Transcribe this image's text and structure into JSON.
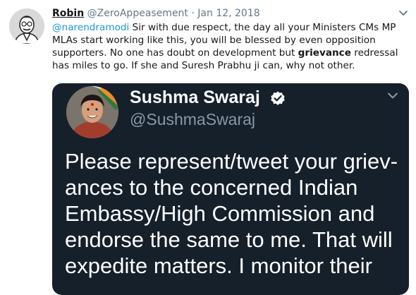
{
  "tweet": {
    "author_name": "Robin",
    "author_handle": "@ZeroAppeasement",
    "separator": "·",
    "date": "Jan 12, 2018",
    "mention": "@narendramodi",
    "text_part1": " Sir with due respect, the day all your Ministers CMs MP MLAs start working like this, you will be blessed by even opposition supporters. No one has doubt on development but ",
    "bold_word": "grievance",
    "text_part2": " redressal has miles to go. If she and Suresh Prabhu ji can, why not other.",
    "icons": {
      "avatar": "cartoon-avatar-icon",
      "menu": "chevron-down-icon"
    }
  },
  "quoted": {
    "author_name": "Sushma Swaraj",
    "author_handle": "@SushmaSwaraj",
    "lines": [
      "Please represent/tweet your griev-",
      "ances to the concerned Indian",
      "Embassy/High Commission and",
      "endorse the same to me. That will",
      "expedite matters. I monitor their"
    ],
    "icons": {
      "avatar": "portrait-avatar-icon",
      "verified": "verified-badge-icon",
      "menu": "chevron-down-icon"
    },
    "colors": {
      "background": "#15202b",
      "verified": "#ffffff"
    }
  }
}
